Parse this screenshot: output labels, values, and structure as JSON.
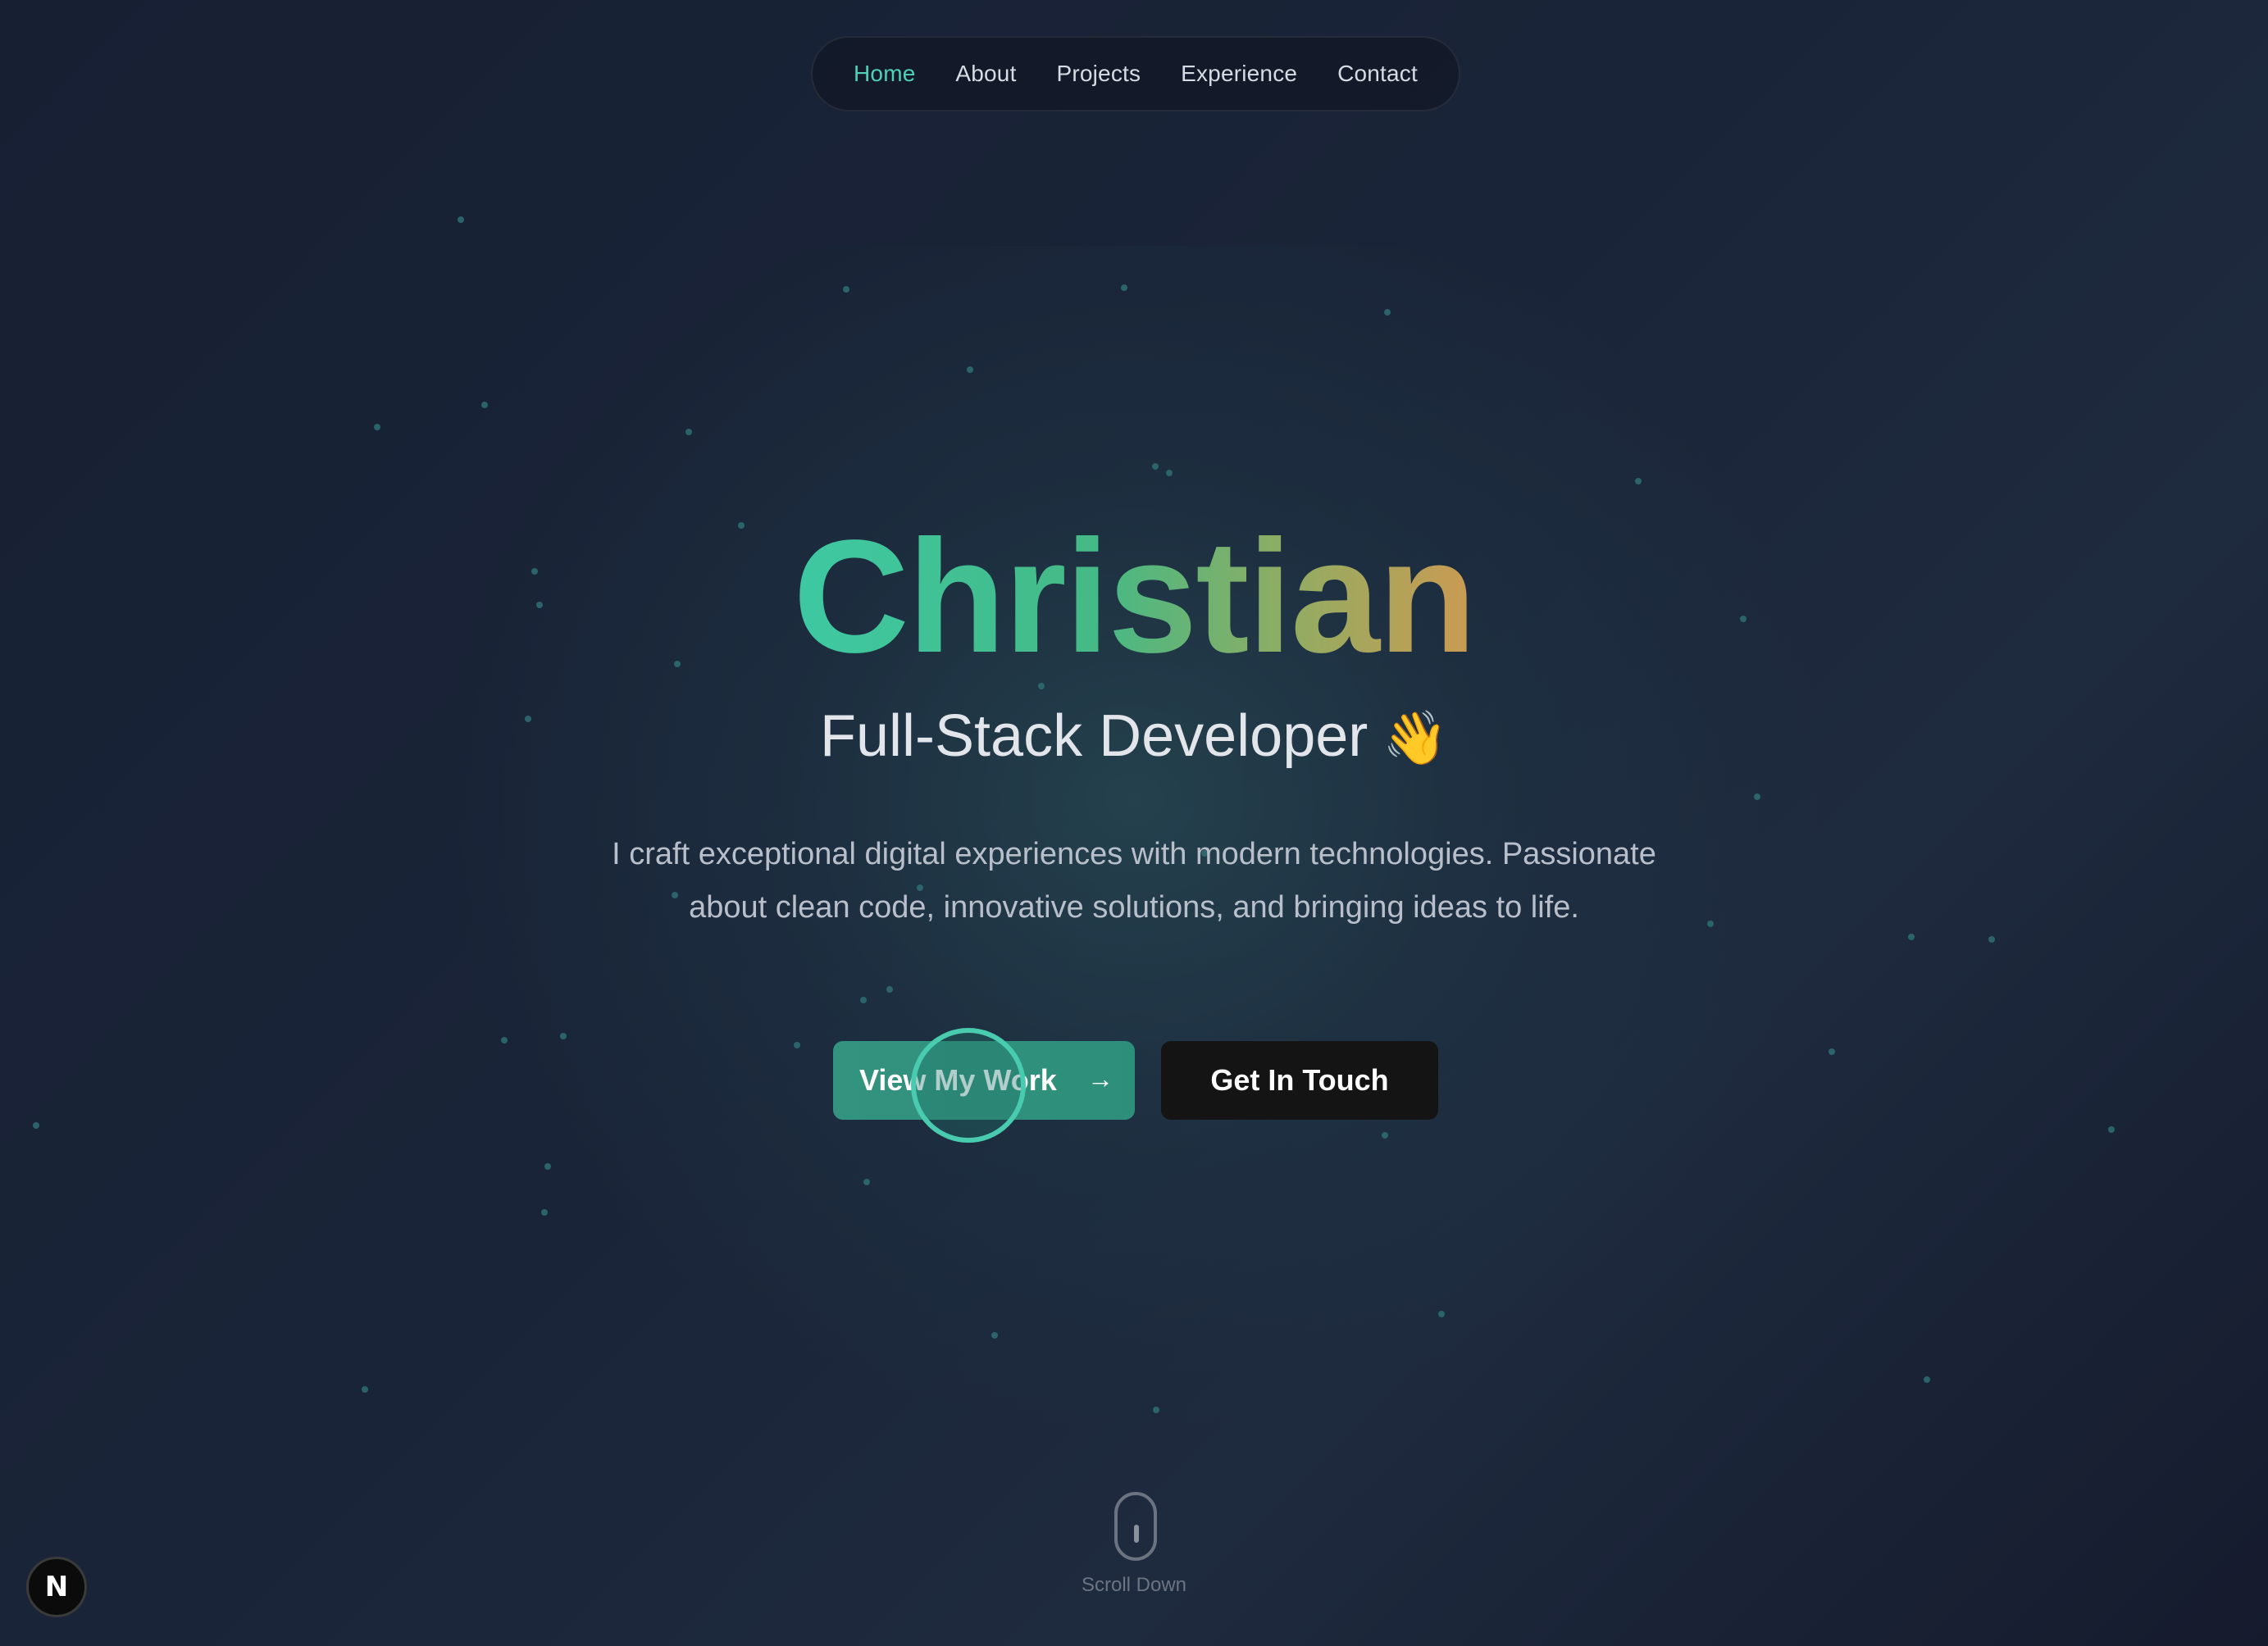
{
  "nav": {
    "items": [
      {
        "label": "Home",
        "active": true
      },
      {
        "label": "About",
        "active": false
      },
      {
        "label": "Projects",
        "active": false
      },
      {
        "label": "Experience",
        "active": false
      },
      {
        "label": "Contact",
        "active": false
      }
    ]
  },
  "hero": {
    "name": "Christian",
    "role": "Full-Stack Developer",
    "role_emoji": "👋",
    "description": "I craft exceptional digital experiences with modern technologies. Passionate about clean code, innovative solutions, and bringing ideas to life.",
    "primary_button": "View My Work",
    "primary_button_icon": "→",
    "secondary_button": "Get In Touch"
  },
  "scroll": {
    "label": "Scroll Down"
  },
  "badge": {
    "letter": "N"
  },
  "colors": {
    "accent": "#4fd1b5",
    "primary_button": "#2f917b",
    "secondary_button": "#141414",
    "gradient_start": "#3ec9a3",
    "gradient_end": "#cc9a52"
  }
}
